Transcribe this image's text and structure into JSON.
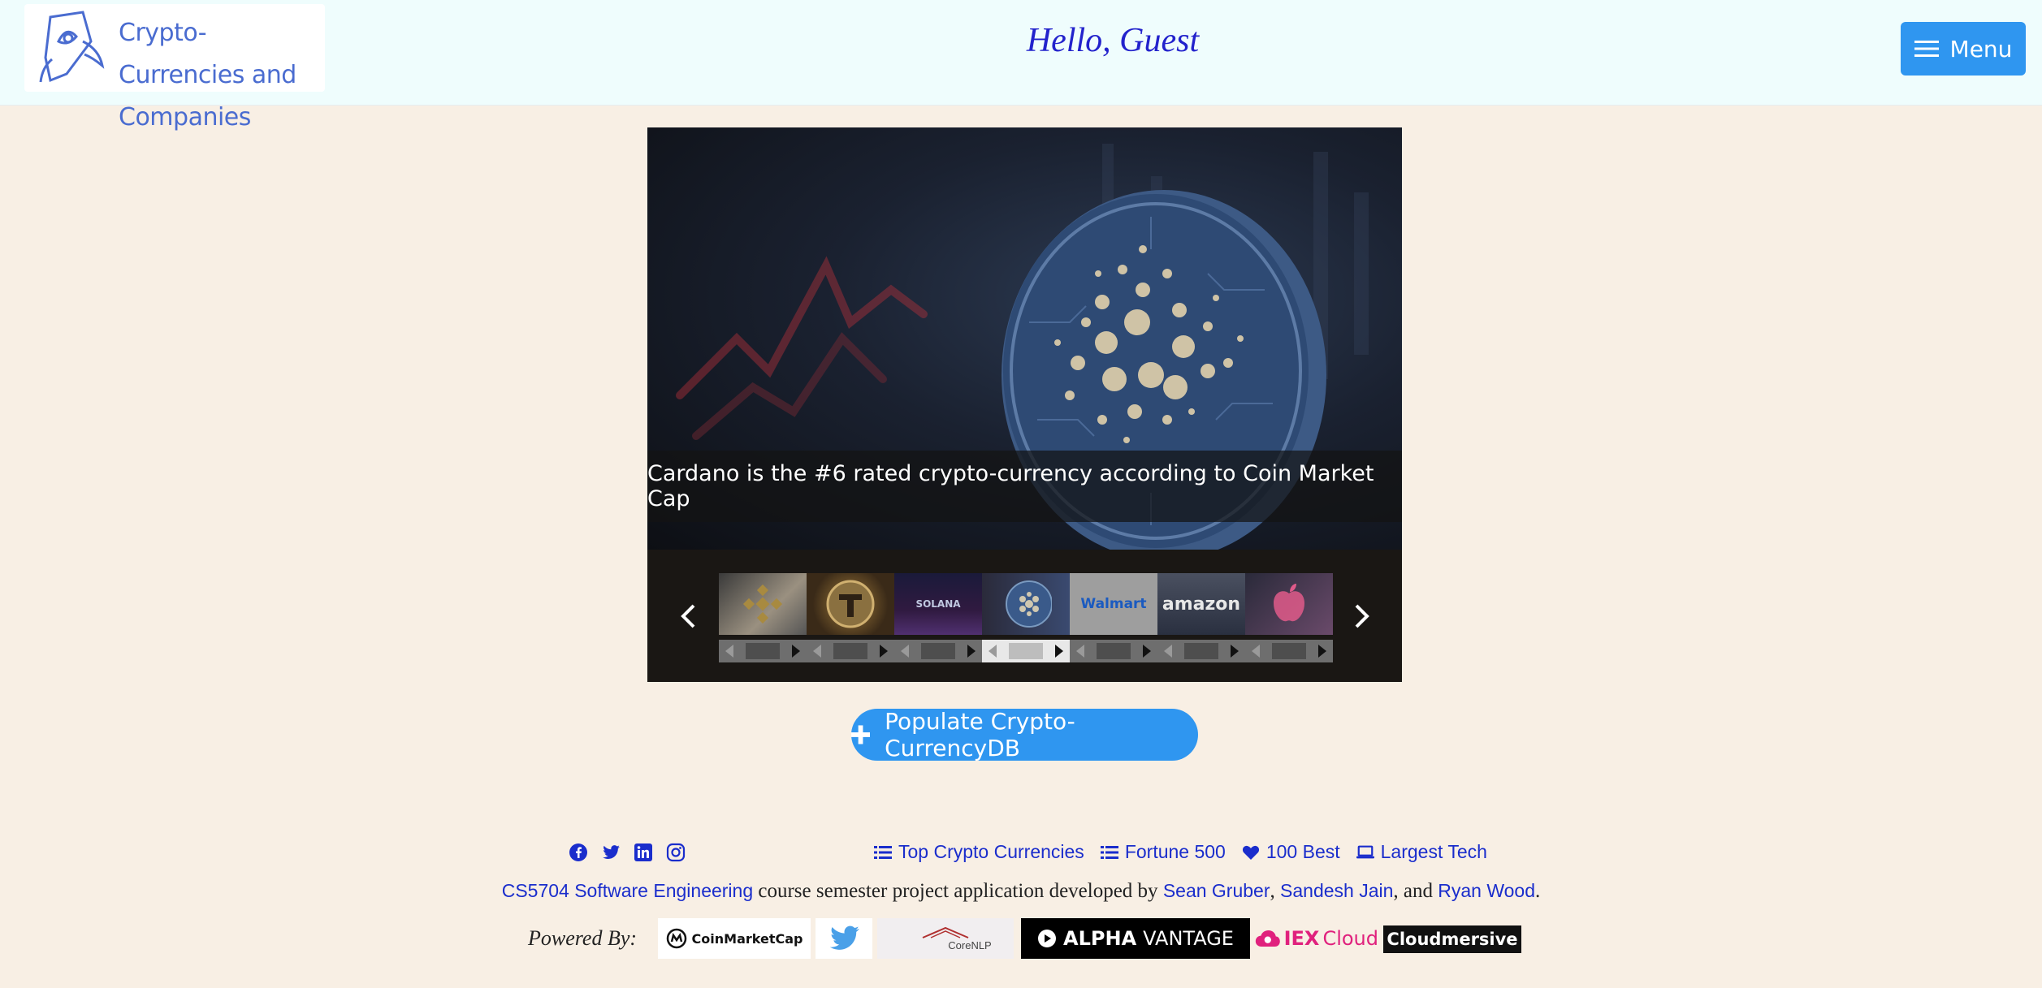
{
  "header": {
    "logo_line1": "Crypto-Currencies and",
    "logo_line2": "Companies",
    "greeting": "Hello, Guest",
    "menu_label": "Menu"
  },
  "carousel": {
    "caption": "Cardano is the #6 rated crypto-currency according to Coin Market Cap",
    "active_index": 3,
    "thumbnails": [
      {
        "name": "binance",
        "label": "BINANCE"
      },
      {
        "name": "tether",
        "label": ""
      },
      {
        "name": "solana",
        "label": "SOLANA"
      },
      {
        "name": "cardano",
        "label": ""
      },
      {
        "name": "walmart",
        "label": "Walmart"
      },
      {
        "name": "amazon",
        "label": "amazon"
      },
      {
        "name": "apple",
        "label": ""
      }
    ]
  },
  "populate_button": "Populate Crypto-CurrencyDB",
  "footer": {
    "links": {
      "top_crypto": "Top Crypto Currencies",
      "fortune": "Fortune 500",
      "best": "100 Best",
      "tech": "Largest Tech"
    },
    "credits": {
      "course": "CS5704 Software Engineering",
      "middle": " course semester project application developed by ",
      "author1": "Sean Gruber",
      "sep1": ", ",
      "author2": "Sandesh Jain",
      "sep2": ", and ",
      "author3": "Ryan Wood",
      "end": "."
    },
    "powered_by": "Powered By:",
    "partners": {
      "coinmarketcap": "CoinMarketCap",
      "corenlp": "CoreNLP",
      "alpha_vantage_1": "ALPHA",
      "alpha_vantage_2": "VANTAGE",
      "iex_1": "IEX",
      "iex_2": "Cloud",
      "cloudmersive": "Cloudmersive"
    }
  },
  "colors": {
    "accent": "#2f96f0",
    "link": "#1a2dcc",
    "page_bg": "#f8efe4",
    "header_bg": "#effdfd"
  }
}
